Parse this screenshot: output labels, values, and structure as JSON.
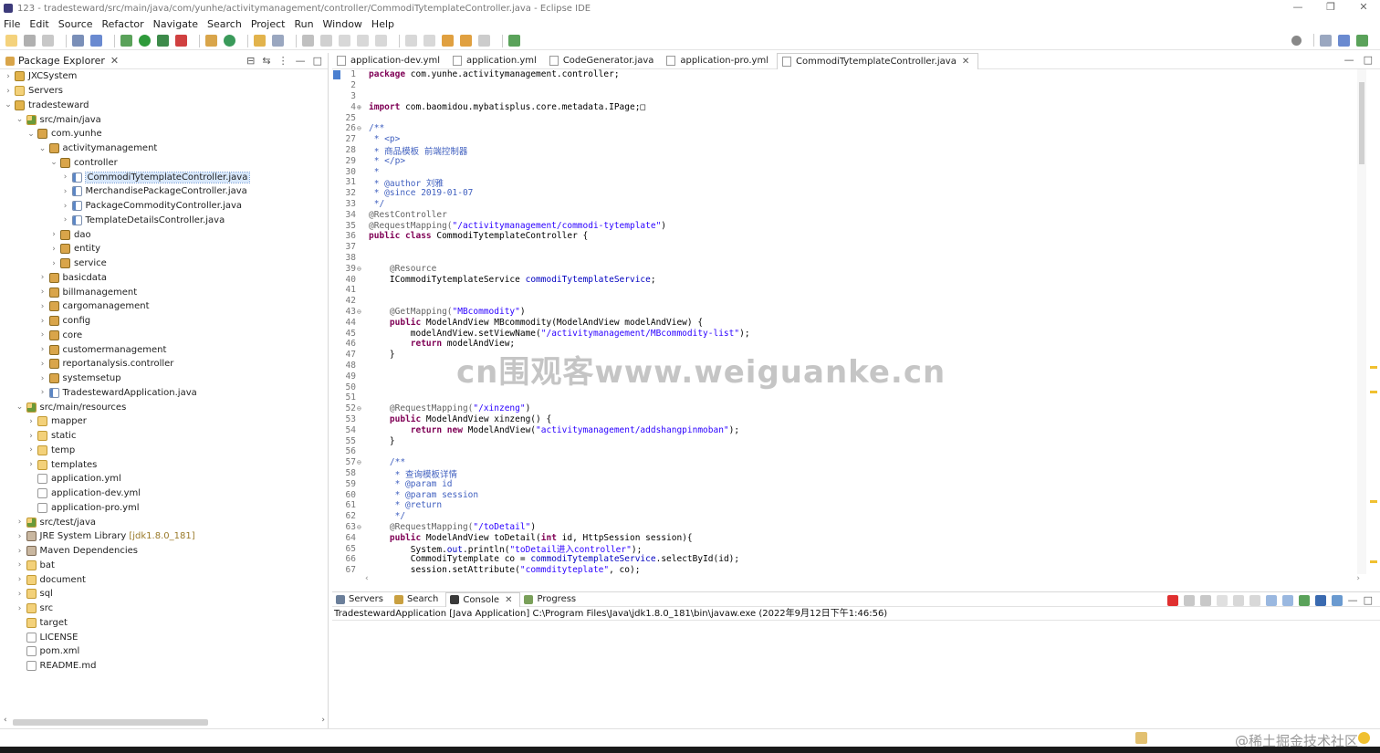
{
  "window": {
    "title": "123 - tradesteward/src/main/java/com/yunhe/activitymanagement/controller/CommodiTytemplateController.java - Eclipse IDE",
    "minimize": "—",
    "restore": "❐",
    "close": "✕"
  },
  "menu": [
    "File",
    "Edit",
    "Source",
    "Refactor",
    "Navigate",
    "Search",
    "Project",
    "Run",
    "Window",
    "Help"
  ],
  "explorer": {
    "title": "Package Explorer",
    "close": "✕",
    "tree": [
      {
        "label": "JXCSystem",
        "indent": 0,
        "arrow": "›",
        "icon": "project"
      },
      {
        "label": "Servers",
        "indent": 0,
        "arrow": "›",
        "icon": "folder"
      },
      {
        "label": "tradesteward",
        "indent": 0,
        "arrow": "⌄",
        "icon": "project"
      },
      {
        "label": "src/main/java",
        "indent": 1,
        "arrow": "⌄",
        "icon": "srcfolder"
      },
      {
        "label": "com.yunhe",
        "indent": 2,
        "arrow": "⌄",
        "icon": "package"
      },
      {
        "label": "activitymanagement",
        "indent": 3,
        "arrow": "⌄",
        "icon": "package"
      },
      {
        "label": "controller",
        "indent": 4,
        "arrow": "⌄",
        "icon": "package"
      },
      {
        "label": "CommodiTytemplateController.java",
        "indent": 5,
        "arrow": "›",
        "icon": "java",
        "selected": true
      },
      {
        "label": "MerchandisePackageController.java",
        "indent": 5,
        "arrow": "›",
        "icon": "java"
      },
      {
        "label": "PackageCommodityController.java",
        "indent": 5,
        "arrow": "›",
        "icon": "java"
      },
      {
        "label": "TemplateDetailsController.java",
        "indent": 5,
        "arrow": "›",
        "icon": "java"
      },
      {
        "label": "dao",
        "indent": 4,
        "arrow": "›",
        "icon": "package"
      },
      {
        "label": "entity",
        "indent": 4,
        "arrow": "›",
        "icon": "package"
      },
      {
        "label": "service",
        "indent": 4,
        "arrow": "›",
        "icon": "package"
      },
      {
        "label": "basicdata",
        "indent": 3,
        "arrow": "›",
        "icon": "package"
      },
      {
        "label": "billmanagement",
        "indent": 3,
        "arrow": "›",
        "icon": "package"
      },
      {
        "label": "cargomanagement",
        "indent": 3,
        "arrow": "›",
        "icon": "package"
      },
      {
        "label": "config",
        "indent": 3,
        "arrow": "›",
        "icon": "package"
      },
      {
        "label": "core",
        "indent": 3,
        "arrow": "›",
        "icon": "package"
      },
      {
        "label": "customermanagement",
        "indent": 3,
        "arrow": "›",
        "icon": "package"
      },
      {
        "label": "reportanalysis.controller",
        "indent": 3,
        "arrow": "›",
        "icon": "package"
      },
      {
        "label": "systemsetup",
        "indent": 3,
        "arrow": "›",
        "icon": "package"
      },
      {
        "label": "TradestewardApplication.java",
        "indent": 3,
        "arrow": "›",
        "icon": "java"
      },
      {
        "label": "src/main/resources",
        "indent": 1,
        "arrow": "⌄",
        "icon": "srcfolder"
      },
      {
        "label": "mapper",
        "indent": 2,
        "arrow": "›",
        "icon": "folder"
      },
      {
        "label": "static",
        "indent": 2,
        "arrow": "›",
        "icon": "folder"
      },
      {
        "label": "temp",
        "indent": 2,
        "arrow": "›",
        "icon": "folder"
      },
      {
        "label": "templates",
        "indent": 2,
        "arrow": "›",
        "icon": "folder"
      },
      {
        "label": "application.yml",
        "indent": 2,
        "arrow": "",
        "icon": "file"
      },
      {
        "label": "application-dev.yml",
        "indent": 2,
        "arrow": "",
        "icon": "file"
      },
      {
        "label": "application-pro.yml",
        "indent": 2,
        "arrow": "",
        "icon": "file"
      },
      {
        "label": "src/test/java",
        "indent": 1,
        "arrow": "›",
        "icon": "srcfolder"
      },
      {
        "label": "JRE System Library",
        "indent": 1,
        "arrow": "›",
        "icon": "lib",
        "suffix": "[jdk1.8.0_181]"
      },
      {
        "label": "Maven Dependencies",
        "indent": 1,
        "arrow": "›",
        "icon": "lib"
      },
      {
        "label": "bat",
        "indent": 1,
        "arrow": "›",
        "icon": "folder"
      },
      {
        "label": "document",
        "indent": 1,
        "arrow": "›",
        "icon": "folder"
      },
      {
        "label": "sql",
        "indent": 1,
        "arrow": "›",
        "icon": "folder"
      },
      {
        "label": "src",
        "indent": 1,
        "arrow": "›",
        "icon": "folder"
      },
      {
        "label": "target",
        "indent": 1,
        "arrow": "",
        "icon": "folder"
      },
      {
        "label": "LICENSE",
        "indent": 1,
        "arrow": "",
        "icon": "file"
      },
      {
        "label": "pom.xml",
        "indent": 1,
        "arrow": "",
        "icon": "file"
      },
      {
        "label": "README.md",
        "indent": 1,
        "arrow": "",
        "icon": "file"
      }
    ]
  },
  "editor": {
    "tabs": [
      {
        "label": "application-dev.yml"
      },
      {
        "label": "application.yml"
      },
      {
        "label": "CodeGenerator.java"
      },
      {
        "label": "application-pro.yml"
      },
      {
        "label": "CommodiTytemplateController.java",
        "active": true
      }
    ],
    "tab_close": "✕",
    "lines": [
      {
        "n": "1",
        "f": "",
        "segs": [
          [
            "kw",
            "package"
          ],
          [
            "",
            "com.yunhe.activitymanagement.controller;"
          ]
        ]
      },
      {
        "n": "2",
        "f": "",
        "segs": []
      },
      {
        "n": "3",
        "f": "",
        "segs": []
      },
      {
        "n": "4",
        "f": "⊕",
        "segs": [
          [
            "kw",
            "import"
          ],
          [
            "",
            "com.baomidou.mybatisplus.core.metadata.IPage;□"
          ]
        ]
      },
      {
        "n": "25",
        "f": "",
        "segs": []
      },
      {
        "n": "26",
        "f": "⊖",
        "segs": [
          [
            "cm",
            "/**"
          ]
        ]
      },
      {
        "n": "27",
        "f": "",
        "segs": [
          [
            "cm",
            " * <p>"
          ]
        ]
      },
      {
        "n": "28",
        "f": "",
        "segs": [
          [
            "cm",
            " * 商品模板 前端控制器"
          ]
        ]
      },
      {
        "n": "29",
        "f": "",
        "segs": [
          [
            "cm",
            " * </p>"
          ]
        ]
      },
      {
        "n": "30",
        "f": "",
        "segs": [
          [
            "cm",
            " *"
          ]
        ]
      },
      {
        "n": "31",
        "f": "",
        "segs": [
          [
            "cm",
            " * @author 刘雅"
          ]
        ]
      },
      {
        "n": "32",
        "f": "",
        "segs": [
          [
            "cm",
            " * @since 2019-01-07"
          ]
        ]
      },
      {
        "n": "33",
        "f": "",
        "segs": [
          [
            "cm",
            " */"
          ]
        ]
      },
      {
        "n": "34",
        "f": "",
        "segs": [
          [
            "an",
            "@RestController"
          ]
        ]
      },
      {
        "n": "35",
        "f": "",
        "segs": [
          [
            "an",
            "@RequestMapping("
          ],
          [
            "str",
            "\"/activitymanagement/commodi-tytemplate\""
          ],
          [
            "",
            ")"
          ]
        ]
      },
      {
        "n": "36",
        "f": "",
        "segs": [
          [
            "kw",
            "public class"
          ],
          [
            "",
            " CommodiTytemplateController {"
          ]
        ]
      },
      {
        "n": "37",
        "f": "",
        "segs": []
      },
      {
        "n": "38",
        "f": "",
        "segs": []
      },
      {
        "n": "39",
        "f": "⊖",
        "segs": [
          [
            "an",
            "    @Resource"
          ]
        ]
      },
      {
        "n": "40",
        "f": "",
        "segs": [
          [
            "",
            "    ICommodiTytemplateService "
          ],
          [
            "fld",
            "commodiTytemplateService"
          ],
          [
            "",
            ";"
          ]
        ]
      },
      {
        "n": "41",
        "f": "",
        "segs": []
      },
      {
        "n": "42",
        "f": "",
        "segs": []
      },
      {
        "n": "43",
        "f": "⊖",
        "segs": [
          [
            "an",
            "    @GetMapping("
          ],
          [
            "str",
            "\"MBcommodity\""
          ],
          [
            "",
            ")"
          ]
        ]
      },
      {
        "n": "44",
        "f": "",
        "segs": [
          [
            "kw",
            "    public"
          ],
          [
            "",
            " ModelAndView MBcommodity(ModelAndView modelAndView) {"
          ]
        ]
      },
      {
        "n": "45",
        "f": "",
        "segs": [
          [
            "",
            "        modelAndView.setViewName("
          ],
          [
            "str",
            "\"/activitymanagement/MBcommodity-list\""
          ],
          [
            "",
            ");"
          ]
        ]
      },
      {
        "n": "46",
        "f": "",
        "segs": [
          [
            "kw",
            "        return"
          ],
          [
            "",
            " modelAndView;"
          ]
        ]
      },
      {
        "n": "47",
        "f": "",
        "segs": [
          [
            "",
            "    }"
          ]
        ]
      },
      {
        "n": "48",
        "f": "",
        "segs": []
      },
      {
        "n": "49",
        "f": "",
        "segs": []
      },
      {
        "n": "50",
        "f": "",
        "segs": []
      },
      {
        "n": "51",
        "f": "",
        "segs": []
      },
      {
        "n": "52",
        "f": "⊖",
        "segs": [
          [
            "an",
            "    @RequestMapping("
          ],
          [
            "str",
            "\"/xinzeng\""
          ],
          [
            "",
            ")"
          ]
        ]
      },
      {
        "n": "53",
        "f": "",
        "segs": [
          [
            "kw",
            "    public"
          ],
          [
            "",
            " ModelAndView xinzeng() {"
          ]
        ]
      },
      {
        "n": "54",
        "f": "",
        "segs": [
          [
            "kw",
            "        return new"
          ],
          [
            "",
            " ModelAndView("
          ],
          [
            "str",
            "\"activitymanagement/addshangpinmoban\""
          ],
          [
            "",
            ");"
          ]
        ]
      },
      {
        "n": "55",
        "f": "",
        "segs": [
          [
            "",
            "    }"
          ]
        ]
      },
      {
        "n": "56",
        "f": "",
        "segs": []
      },
      {
        "n": "57",
        "f": "⊖",
        "segs": [
          [
            "cm",
            "    /**"
          ]
        ]
      },
      {
        "n": "58",
        "f": "",
        "segs": [
          [
            "cm",
            "     * 查询模板详情"
          ]
        ]
      },
      {
        "n": "59",
        "f": "",
        "segs": [
          [
            "cm",
            "     * @param id"
          ]
        ]
      },
      {
        "n": "60",
        "f": "",
        "segs": [
          [
            "cm",
            "     * @param session"
          ]
        ]
      },
      {
        "n": "61",
        "f": "",
        "segs": [
          [
            "cm",
            "     * @return"
          ]
        ]
      },
      {
        "n": "62",
        "f": "",
        "segs": [
          [
            "cm",
            "     */"
          ]
        ]
      },
      {
        "n": "63",
        "f": "⊖",
        "segs": [
          [
            "an",
            "    @RequestMapping("
          ],
          [
            "str",
            "\"/toDetail\""
          ],
          [
            "",
            ")"
          ]
        ]
      },
      {
        "n": "64",
        "f": "",
        "segs": [
          [
            "kw",
            "    public"
          ],
          [
            "",
            " ModelAndView toDetail("
          ],
          [
            "kw",
            "int"
          ],
          [
            "",
            " id, HttpSession session){"
          ]
        ]
      },
      {
        "n": "65",
        "f": "",
        "segs": [
          [
            "",
            "        System."
          ],
          [
            "fld",
            "out"
          ],
          [
            "",
            ".println("
          ],
          [
            "str",
            "\"toDetail进入controller\""
          ],
          [
            "",
            ");"
          ]
        ]
      },
      {
        "n": "66",
        "f": "",
        "segs": [
          [
            "",
            "        CommodiTytemplate co = "
          ],
          [
            "fld",
            "commodiTytemplateService"
          ],
          [
            "",
            ".selectById(id);"
          ]
        ]
      },
      {
        "n": "67",
        "f": "",
        "segs": [
          [
            "",
            "        session.setAttribute("
          ],
          [
            "str",
            "\"commdityteplate\""
          ],
          [
            "",
            ", co);"
          ]
        ]
      }
    ]
  },
  "console": {
    "tabs": [
      {
        "label": "Servers"
      },
      {
        "label": "Search"
      },
      {
        "label": "Console",
        "active": true
      },
      {
        "label": "Progress"
      }
    ],
    "header": "TradestewardApplication [Java Application] C:\\Program Files\\Java\\jdk1.8.0_181\\bin\\javaw.exe  (2022年9月12日下午1:46:56)"
  },
  "watermarks": {
    "center": "cn围观客www.weiguanke.cn",
    "bottom": "@稀土掘金技术社区"
  },
  "colors": {
    "keyword": "#7f0055",
    "string": "#2a00ff",
    "comment": "#3f5fbf",
    "annotation": "#646464",
    "field": "#0000c0",
    "selection": "#d7e7fb"
  }
}
